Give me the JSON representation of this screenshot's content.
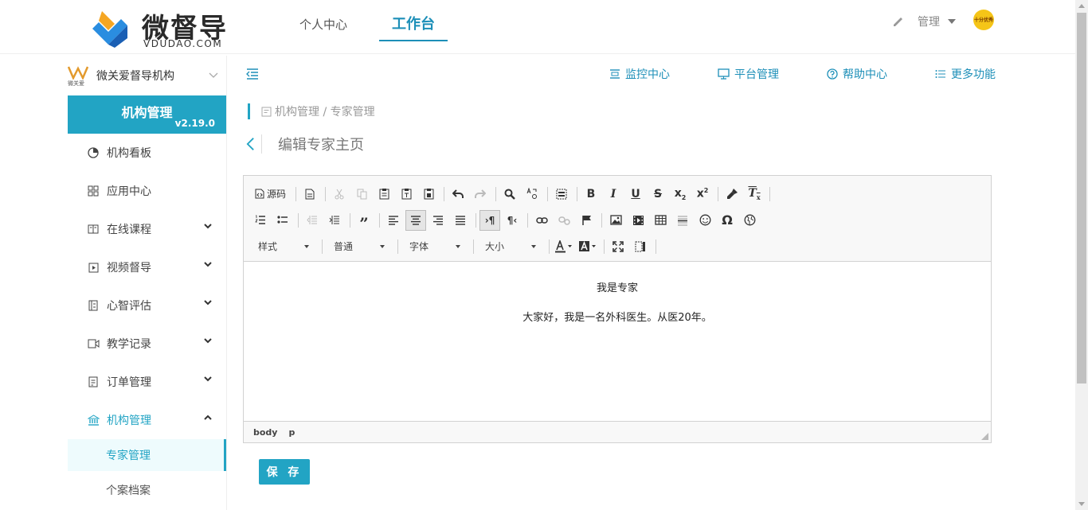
{
  "brand": {
    "name": "微督导",
    "sub": "VDUDAO.COM"
  },
  "topnav": {
    "tabs": [
      {
        "label": "个人中心"
      },
      {
        "label": "工作台"
      }
    ],
    "active": "工作台"
  },
  "user": {
    "role_label": "管理",
    "avatar_text": "十分优秀"
  },
  "org": {
    "name": "微关爱督导机构",
    "logo_text": "微关爱"
  },
  "panel": {
    "title": "机构管理",
    "version": "v2.19.0"
  },
  "sidebar": {
    "items": [
      {
        "label": "机构看板",
        "icon": "dashboard-icon"
      },
      {
        "label": "应用中心",
        "icon": "grid-icon"
      },
      {
        "label": "在线课程",
        "icon": "book-icon"
      },
      {
        "label": "视频督导",
        "icon": "video-play-icon"
      },
      {
        "label": "心智评估",
        "icon": "list-doc-icon"
      },
      {
        "label": "教学记录",
        "icon": "camera-icon"
      },
      {
        "label": "订单管理",
        "icon": "order-icon"
      },
      {
        "label": "机构管理",
        "icon": "bank-icon"
      }
    ],
    "subitems": [
      {
        "label": "专家管理"
      },
      {
        "label": "个案档案"
      }
    ]
  },
  "subnav": [
    {
      "label": "监控中心",
      "icon": "monitor-icon"
    },
    {
      "label": "平台管理",
      "icon": "desktop-icon"
    },
    {
      "label": "帮助中心",
      "icon": "help-icon"
    },
    {
      "label": "更多功能",
      "icon": "list-icon"
    }
  ],
  "breadcrumb": "机构管理 / 专家管理",
  "page_title": "编辑专家主页",
  "editor": {
    "source_label": "源码",
    "combos": [
      {
        "label": "样式"
      },
      {
        "label": "普通"
      },
      {
        "label": "字体"
      },
      {
        "label": "大小"
      }
    ],
    "content": [
      "我是专家",
      "大家好，我是一名外科医生。从医20年。"
    ],
    "path": [
      "body",
      "p"
    ]
  },
  "save_label": "保 存",
  "colors": {
    "accent": "#22a4c4",
    "link": "#1d8fb8"
  }
}
